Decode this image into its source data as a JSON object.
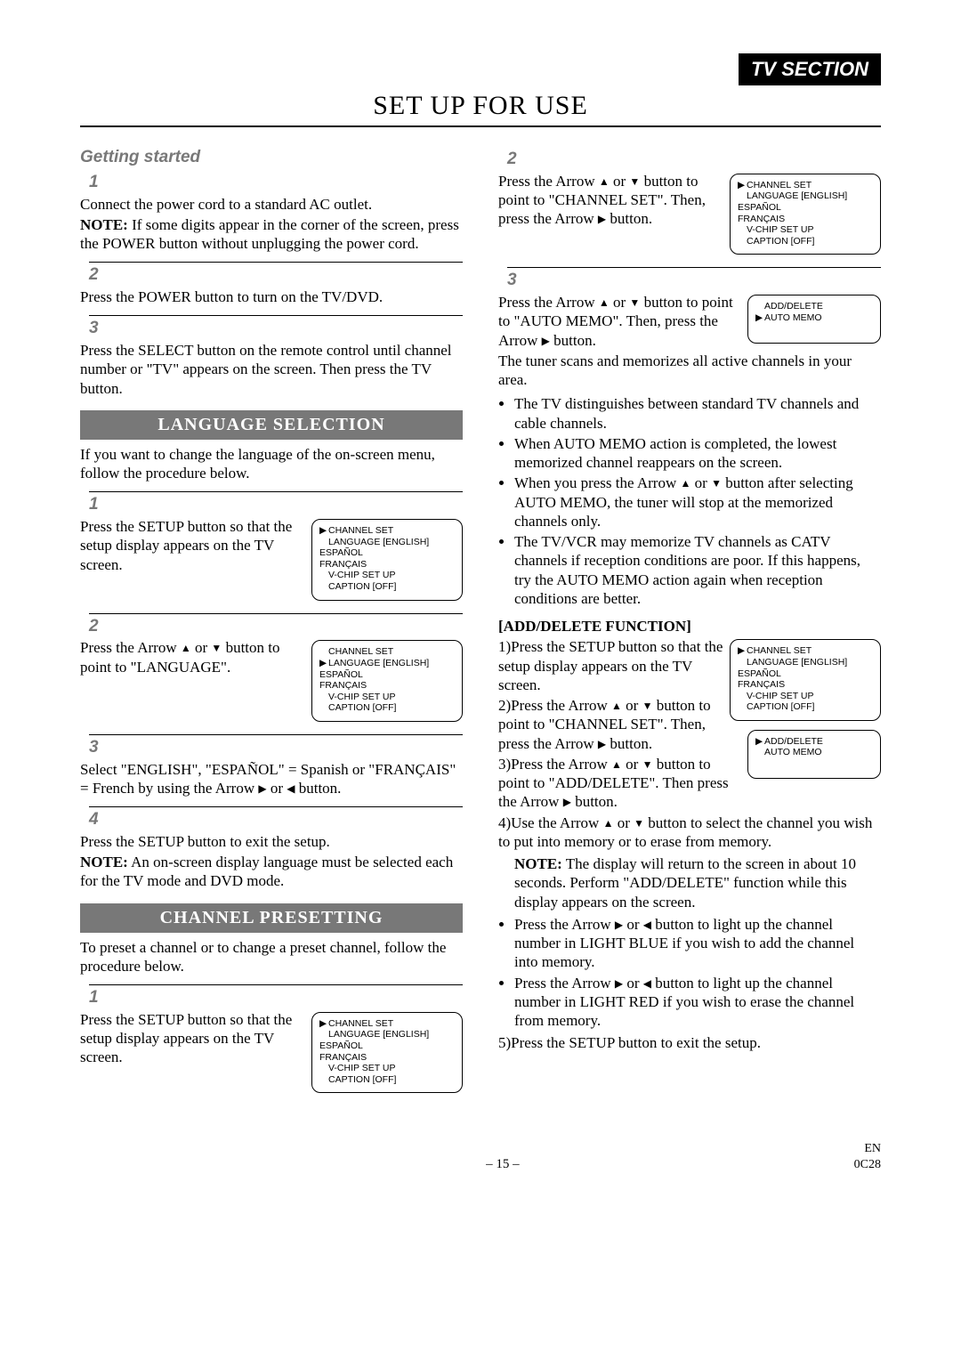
{
  "header": {
    "tv_section": "TV SECTION",
    "page_title": "SET UP FOR USE"
  },
  "left": {
    "getting_started": "Getting started",
    "s1_num": "1",
    "s1_p1": "Connect the power cord to a standard AC outlet.",
    "s1_p2a": "NOTE:",
    "s1_p2b": " If some digits appear in the corner of the screen, press the POWER button without unplugging the power cord.",
    "s2_num": "2",
    "s2_p1": "Press the POWER button to turn on the TV/DVD.",
    "s3_num": "3",
    "s3_p1": "Press the SELECT button on the remote control until channel number or \"TV\" appears on the screen. Then press the TV button.",
    "lang_bar": "LANGUAGE SELECTION",
    "lang_intro": "If you want to change the language of the on-screen menu, follow the procedure below.",
    "ls1_num": "1",
    "ls1_p1": "Press the SETUP button so that the setup display appears on the TV screen.",
    "ls2_num": "2",
    "ls2_p1a": "Press the Arrow ",
    "ls2_p1b": " or ",
    "ls2_p1c": " button to point to \"LANGUAGE\".",
    "ls3_num": "3",
    "ls3_p1a": "Select \"ENGLISH\", \"ESPAÑOL\" = Spanish or \"FRANÇAIS\" = French by using the Arrow ",
    "ls3_p1b": " or ",
    "ls3_p1c": " button.",
    "ls4_num": "4",
    "ls4_p1": "Press the SETUP button to exit the setup.",
    "ls4_p2a": "NOTE:",
    "ls4_p2b": " An on-screen display language must be selected each for the TV mode and DVD mode.",
    "chan_bar": "CHANNEL PRESETTING",
    "chan_intro": "To preset a channel or to change a preset channel, follow the procedure below.",
    "cs1_num": "1",
    "cs1_p1": "Press the SETUP button so that the setup display appears on the TV screen."
  },
  "right": {
    "r2_num": "2",
    "r2_p1a": "Press the Arrow ",
    "r2_p1b": " or ",
    "r2_p1c": " button to point to \"CHANNEL SET\". Then, press the Arrow ",
    "r2_p1d": " button.",
    "r3_num": "3",
    "r3_p1a": "Press the Arrow ",
    "r3_p1b": " or ",
    "r3_p1c": " button to point to \"AUTO MEMO\". Then, press the Arrow ",
    "r3_p1d": " button.",
    "r3_p2": "The tuner scans and memorizes all active channels in your area.",
    "b1": "The TV distinguishes between standard TV channels and cable channels.",
    "b2": "When AUTO MEMO action is completed, the lowest memorized channel reappears on the screen.",
    "b3a": "When you press the Arrow ",
    "b3b": " or ",
    "b3c": " button after selecting AUTO MEMO, the tuner will stop at the memorized channels only.",
    "b4": "The TV/VCR may memorize TV channels as CATV channels if reception conditions are poor. If this happens, try the AUTO MEMO action again when reception conditions are better.",
    "add_head": "[ADD/DELETE FUNCTION]",
    "ad1": "1)Press the SETUP button so that the setup display appears on the TV screen.",
    "ad2a": "2)Press the Arrow ",
    "ad2b": " or ",
    "ad2c": " button to point to \"CHANNEL SET\". Then, press the Arrow ",
    "ad2d": " button.",
    "ad3a": "3)Press the Arrow ",
    "ad3b": " or ",
    "ad3c": " button to point to \"ADD/DELETE\". Then press the Arrow ",
    "ad3d": " button.",
    "ad4a": "4)Use the Arrow ",
    "ad4b": " or ",
    "ad4c": " button to select the channel you wish to put into memory or to erase from memory.",
    "ad_note_a": "NOTE:",
    "ad_note_b": " The display will return to the screen in about 10 seconds. Perform \"ADD/DELETE\" function while this display appears on the screen.",
    "ab1a": "Press the Arrow ",
    "ab1b": " or ",
    "ab1c": " button to light up the channel number in LIGHT BLUE if you wish to add the channel into memory.",
    "ab2a": "Press the Arrow ",
    "ab2b": " or ",
    "ab2c": " button to light up the channel number in LIGHT RED if you wish to erase the channel from memory.",
    "ad5": "5)Press the SETUP button to exit the setup."
  },
  "osd": {
    "channel_set": "CHANNEL SET",
    "language_en": "LANGUAGE [ENGLISH]",
    "espanol": "ESPAÑOL",
    "francais": "FRANÇAIS",
    "vchip": "V-CHIP SET UP",
    "caption_off": "CAPTION [OFF]",
    "add_delete": "ADD/DELETE",
    "auto_memo": "AUTO MEMO"
  },
  "footer": {
    "page": "– 15 –",
    "en": "EN",
    "code": "0C28"
  }
}
